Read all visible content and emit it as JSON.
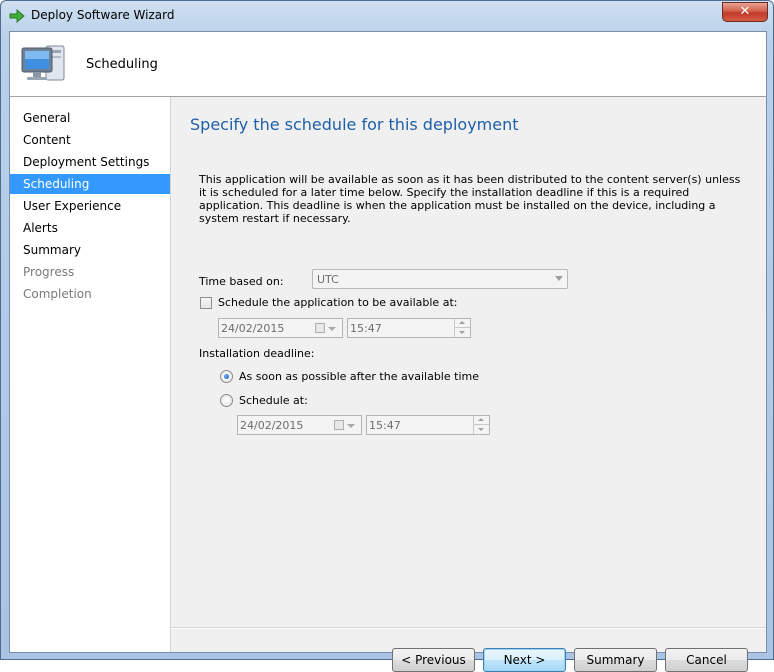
{
  "window": {
    "title": "Deploy Software Wizard",
    "close_label": "✕"
  },
  "banner": {
    "title": "Scheduling"
  },
  "nav": {
    "items": [
      {
        "label": "General",
        "state": "normal"
      },
      {
        "label": "Content",
        "state": "normal"
      },
      {
        "label": "Deployment Settings",
        "state": "normal"
      },
      {
        "label": "Scheduling",
        "state": "selected"
      },
      {
        "label": "User Experience",
        "state": "normal"
      },
      {
        "label": "Alerts",
        "state": "normal"
      },
      {
        "label": "Summary",
        "state": "normal"
      },
      {
        "label": "Progress",
        "state": "disabled"
      },
      {
        "label": "Completion",
        "state": "disabled"
      }
    ]
  },
  "page": {
    "heading": "Specify the schedule for this deployment",
    "description": "This application will be available as soon as it has been distributed to the content server(s) unless it is scheduled for a later time below. Specify the installation deadline if this is a required application. This deadline is when the application must be installed on the device, including a system restart if necessary.",
    "time_based_on": {
      "label": "Time based on:",
      "value": "UTC"
    },
    "available": {
      "checkbox_label": "Schedule the application to be available at:",
      "checked": false,
      "date": "24/02/2015",
      "time": "15:47"
    },
    "deadline": {
      "label": "Installation deadline:",
      "option_asap": "As soon as possible after the available time",
      "option_schedule": "Schedule at:",
      "selected": "asap",
      "date": "24/02/2015",
      "time": "15:47"
    }
  },
  "buttons": {
    "previous": "< Previous",
    "next": "Next >",
    "summary": "Summary",
    "cancel": "Cancel"
  },
  "colors": {
    "heading": "#1f5fa8",
    "selection": "#3399ff"
  }
}
